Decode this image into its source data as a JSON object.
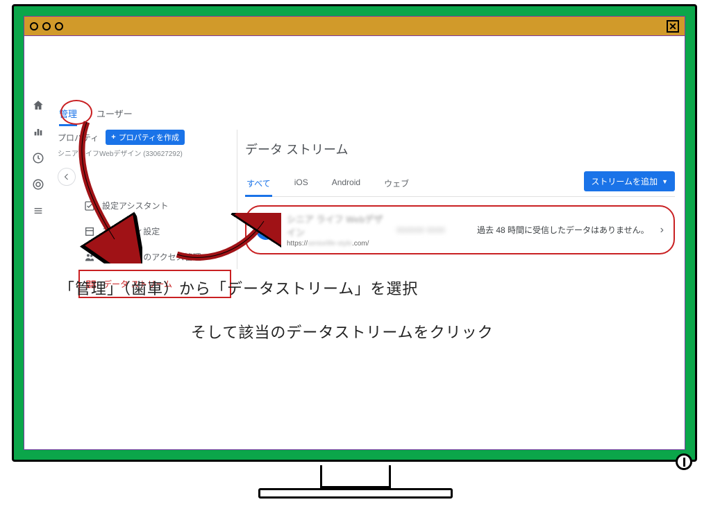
{
  "window": {
    "close_glyph": "✕"
  },
  "leftrail": {
    "icons": [
      "home",
      "bar-chart",
      "clock",
      "target",
      "list"
    ]
  },
  "top_tabs": {
    "admin": "管理",
    "user": "ユーザー"
  },
  "property": {
    "label": "プロパティ",
    "create_button": "プロパティを作成",
    "subtitle": "シニアライフWebデザイン (330627292)"
  },
  "nav": {
    "items": [
      {
        "label": "設定アシスタント",
        "icon": "check"
      },
      {
        "label": "プロパティ設定",
        "icon": "square"
      },
      {
        "label": "プロパティのアクセス管理",
        "icon": "people"
      },
      {
        "label": "データ ストリーム",
        "icon": "stream"
      }
    ]
  },
  "panel": {
    "title": "データ ストリーム",
    "filters": {
      "all": "すべて",
      "ios": "iOS",
      "android": "Android",
      "web": "ウェブ"
    },
    "add_button": "ストリームを追加"
  },
  "stream_row": {
    "name_blurred": "シニア ライフ Webデザイン",
    "url_prefix": "https://",
    "url_host_blurred": "seniorlife-style",
    "url_tail": ".com/",
    "mid_blurred": "000000 0000",
    "status": "過去 48 時間に受信したデータはありません。"
  },
  "captions": {
    "line1": "「管理」（歯車）から「データストリーム」を選択",
    "line2": "そして該当のデータストリームをクリック"
  },
  "colors": {
    "accent": "#1a73e8",
    "annotate": "#c92022",
    "frame": "#0ba64a"
  }
}
